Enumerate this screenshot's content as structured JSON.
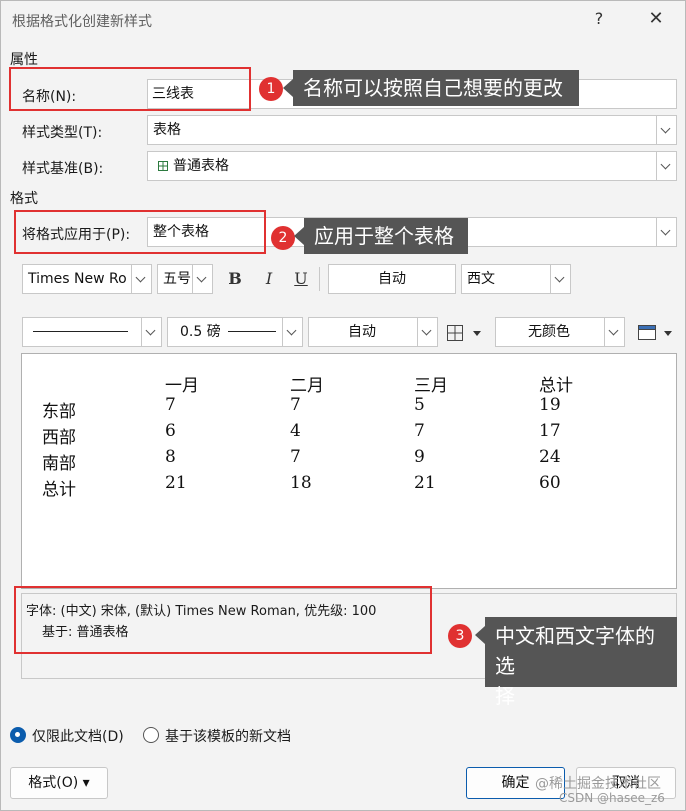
{
  "window": {
    "title": "根据格式化创建新样式",
    "help": "?",
    "close": "✕"
  },
  "properties": {
    "section_label": "属性",
    "name_label": "名称(N):",
    "name_value": "三线表",
    "style_type_label": "样式类型(T):",
    "style_type_value": "表格",
    "style_based_label": "样式基准(B):",
    "style_based_value": "普通表格",
    "table_icon": "table-grid-icon"
  },
  "format": {
    "section_label": "格式",
    "apply_to_label": "将格式应用于(P):",
    "apply_to_value": "整个表格",
    "font_name": "Times New Ro",
    "font_size": "五号",
    "bold": "B",
    "italic": "I",
    "underline": "U",
    "font_color": "自动",
    "script": "西文",
    "line_style": "",
    "line_weight": "0.5 磅",
    "border_color": "自动",
    "borders_icon": "borders-grid-icon",
    "shading": "无颜色",
    "table_styles_icon": "table-styles-icon"
  },
  "preview": {
    "headers": [
      "",
      "一月",
      "二月",
      "三月",
      "总计"
    ],
    "rows": [
      [
        "东部",
        "7",
        "7",
        "5",
        "19"
      ],
      [
        "西部",
        "6",
        "4",
        "7",
        "17"
      ],
      [
        "南部",
        "8",
        "7",
        "9",
        "24"
      ],
      [
        "总计",
        "21",
        "18",
        "21",
        "60"
      ]
    ]
  },
  "description": {
    "line1": "字体: (中文) 宋体, (默认) Times New Roman, 优先级: 100",
    "line2": "基于: 普通表格"
  },
  "scope": {
    "this_document": "仅限此文档(D)",
    "new_documents": "基于该模板的新文档",
    "selected": "this_document"
  },
  "buttons": {
    "format": "格式(O) ▾",
    "ok": "确定",
    "cancel": "取消"
  },
  "annotations": [
    {
      "number": "1",
      "text": "名称可以按照自己想要的更改"
    },
    {
      "number": "2",
      "text": "应用于整个表格"
    },
    {
      "number": "3",
      "text_line1": "中文和西文字体的选",
      "text_line2": "择"
    }
  ],
  "watermark": {
    "line1": "@稀土掘金技术社区",
    "line2": "CSDN @hasee_z6"
  },
  "colors": {
    "annotation_red": "#e03131",
    "callout_bg": "#555555",
    "primary_blue": "#0b5cad"
  }
}
